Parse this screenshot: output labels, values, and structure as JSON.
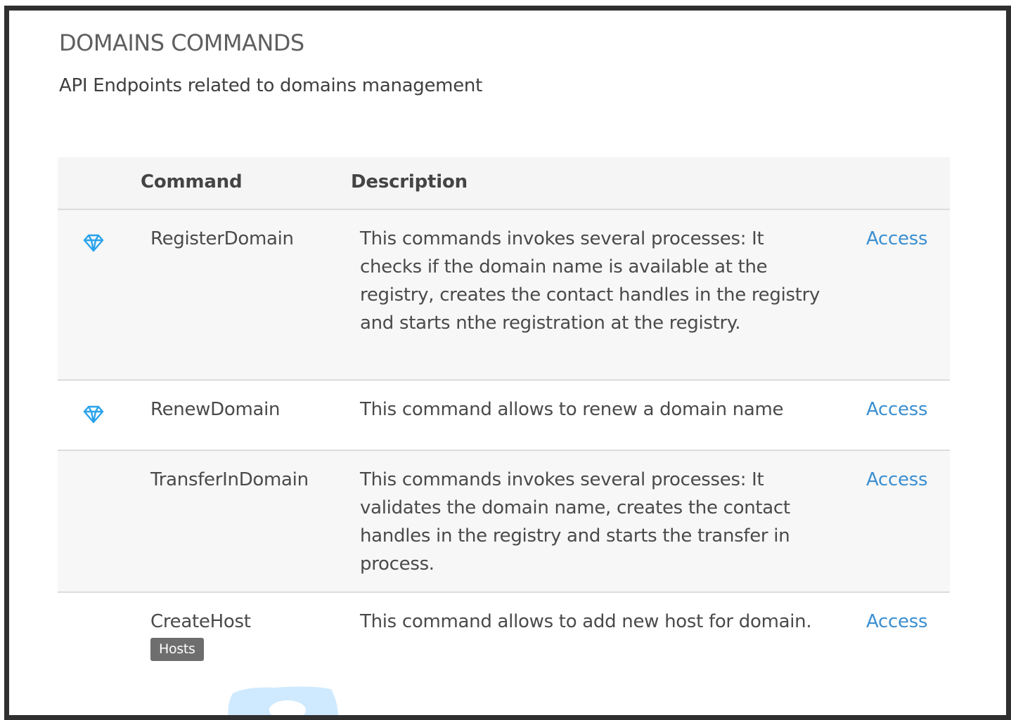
{
  "section": {
    "title": "DOMAINS COMMANDS",
    "subtitle": "API Endpoints related to domains management"
  },
  "table": {
    "headers": {
      "command": "Command",
      "description": "Description"
    },
    "rows": [
      {
        "command": "RegisterDomain",
        "description": "This commands invokes several processes: It checks if the domain name is available at the registry, creates the contact handles in the registry and starts nthe registration at the registry.",
        "link": "Access",
        "icon": "diamond-icon"
      },
      {
        "command": "RenewDomain",
        "description": "This command allows to renew a domain name",
        "link": "Access",
        "icon": "diamond-icon"
      },
      {
        "command": "TransferInDomain",
        "description": "This commands invokes several processes: It validates the domain name, creates the contact handles in the registry and starts the transfer in process.",
        "link": "Access"
      },
      {
        "command": "CreateHost",
        "tag": "Hosts",
        "description": "This command allows to add new host for domain.",
        "link": "Access"
      }
    ]
  },
  "colors": {
    "link": "#3b8fd0",
    "icon": "#29a3ec",
    "tag_bg": "#6e6e6e",
    "header_bg": "#f5f5f6",
    "alt_row_bg": "#f7f7f7"
  }
}
